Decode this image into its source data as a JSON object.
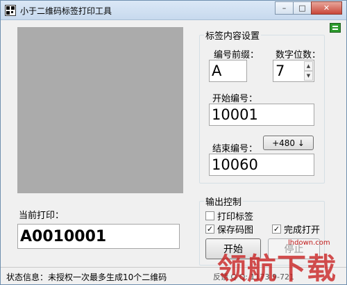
{
  "window": {
    "title": "小于二维码标签打印工具",
    "controls": {
      "minimize": "–",
      "maximize": "□",
      "close": "✕"
    }
  },
  "icons": {
    "app": "qr-code-icon",
    "menu": "green-menu-icon"
  },
  "preview": {
    "label": "当前打印：",
    "value": "A0010001"
  },
  "label_settings": {
    "group_title": "标签内容设置",
    "prefix_label": "编号前缀：",
    "prefix_value": "A",
    "digits_label": "数字位数：",
    "digits_value": "7",
    "start_label": "开始编号：",
    "start_value": "10001",
    "end_label": "结束编号：",
    "end_value": "10060",
    "increment_button": "+480 ↓"
  },
  "output_control": {
    "group_title": "输出控制",
    "print_label": {
      "label": "打印标签",
      "checked": false
    },
    "save_image": {
      "label": "保存码图",
      "checked": true
    },
    "open_when_done": {
      "label": "完成打开",
      "checked": true
    },
    "start_button": "开始",
    "stop_button": "停止"
  },
  "status": {
    "label": "状态信息：未授权一次最多生成10个二维码",
    "info": "反馈 Q Q: 1173 9-721"
  },
  "watermark": {
    "text": "领航下载",
    "url": "lhdown.com"
  },
  "colors": {
    "preview_bg": "#ababab",
    "watermark": "#c81e1e",
    "menu_icon": "#2e9a2e"
  }
}
